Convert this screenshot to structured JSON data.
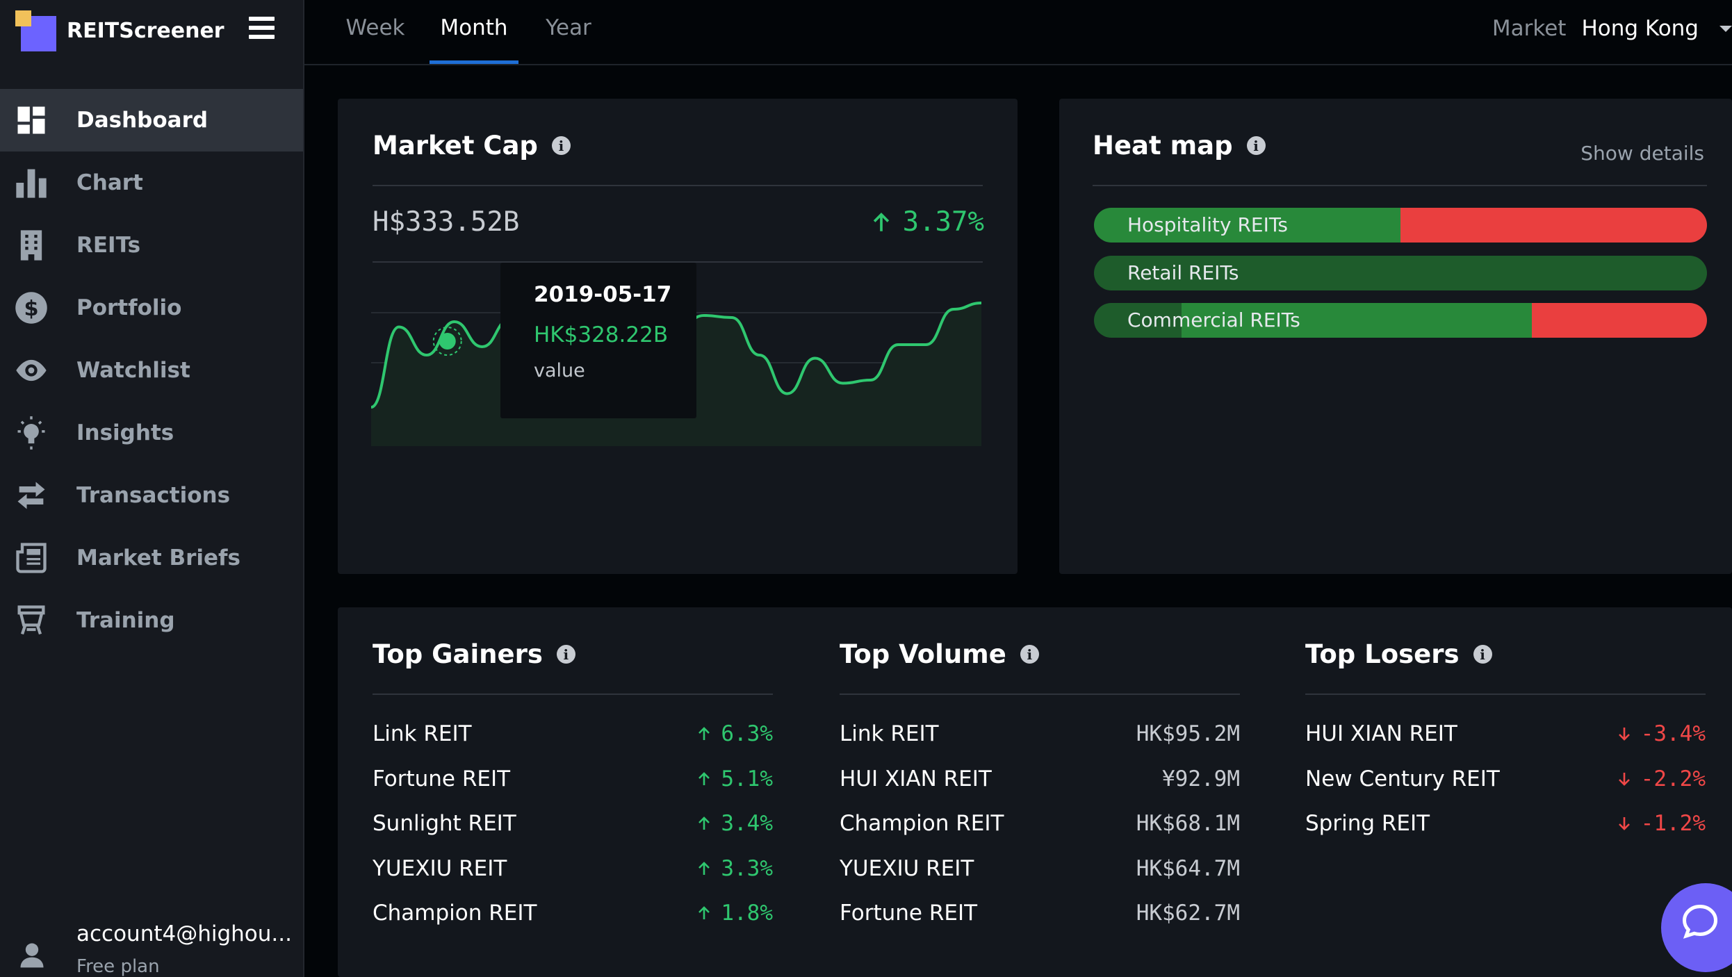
{
  "app": {
    "name": "REITScreener"
  },
  "sidebar": {
    "items": [
      {
        "label": "Dashboard",
        "icon": "dashboard-icon",
        "active": true
      },
      {
        "label": "Chart",
        "icon": "bar-chart-icon"
      },
      {
        "label": "REITs",
        "icon": "building-icon"
      },
      {
        "label": "Portfolio",
        "icon": "dollar-circle-icon"
      },
      {
        "label": "Watchlist",
        "icon": "eye-icon"
      },
      {
        "label": "Insights",
        "icon": "lightbulb-icon"
      },
      {
        "label": "Transactions",
        "icon": "swap-arrows-icon"
      },
      {
        "label": "Market Briefs",
        "icon": "newspaper-icon"
      },
      {
        "label": "Training",
        "icon": "presentation-board-icon"
      }
    ],
    "account": {
      "email": "account4@highou...",
      "plan": "Free plan"
    }
  },
  "topbar": {
    "tabs": [
      {
        "label": "Week"
      },
      {
        "label": "Month",
        "active": true
      },
      {
        "label": "Year"
      }
    ],
    "market_label": "Market",
    "market_value": "Hong Kong"
  },
  "market_cap": {
    "title": "Market Cap",
    "value": "H$333.52B",
    "change": "3.37%",
    "tooltip": {
      "date": "2019-05-17",
      "value": "HK$328.22B",
      "label": "value"
    },
    "chart_data": {
      "type": "area",
      "series": [
        {
          "values": [
            0.0,
            0.77,
            0.5,
            0.82,
            0.58,
            0.84,
            0.88,
            0.83,
            0.9,
            0.78,
            0.86,
            0.74,
            0.88,
            0.86,
            0.5,
            0.13,
            0.47,
            0.23,
            0.26,
            0.6,
            0.6,
            0.94,
            1.0
          ]
        }
      ],
      "highlight_index": 3,
      "grid": true
    }
  },
  "heat_map": {
    "title": "Heat map",
    "show_details": "Show details",
    "bars": [
      {
        "label": "Hospitality REITs",
        "segments": [
          {
            "share": 0.5,
            "color": "#28893a"
          },
          {
            "share": 0.5,
            "color": "#ea3f3f"
          }
        ]
      },
      {
        "label": "Retail REITs",
        "segments": [
          {
            "share": 1.0,
            "color": "#1e5c2b"
          }
        ]
      },
      {
        "label": "Commercial REITs",
        "segments": [
          {
            "share": 0.143,
            "color": "#1e5c2b"
          },
          {
            "share": 0.571,
            "color": "#28893a"
          },
          {
            "share": 0.286,
            "color": "#ea3f3f"
          }
        ]
      }
    ]
  },
  "top_gainers": {
    "title": "Top Gainers",
    "rows": [
      {
        "name": "Link REIT",
        "value": "6.3%"
      },
      {
        "name": "Fortune REIT",
        "value": "5.1%"
      },
      {
        "name": "Sunlight REIT",
        "value": "3.4%"
      },
      {
        "name": "YUEXIU REIT",
        "value": "3.3%"
      },
      {
        "name": "Champion REIT",
        "value": "1.8%"
      }
    ]
  },
  "top_volume": {
    "title": "Top Volume",
    "rows": [
      {
        "name": "Link REIT",
        "value": "HK$95.2M"
      },
      {
        "name": "HUI XIAN REIT",
        "value": "¥92.9M"
      },
      {
        "name": "Champion REIT",
        "value": "HK$68.1M"
      },
      {
        "name": "YUEXIU REIT",
        "value": "HK$64.7M"
      },
      {
        "name": "Fortune REIT",
        "value": "HK$62.7M"
      }
    ]
  },
  "top_losers": {
    "title": "Top Losers",
    "rows": [
      {
        "name": "HUI XIAN REIT",
        "value": "-3.4%"
      },
      {
        "name": "New Century REIT",
        "value": "-2.2%"
      },
      {
        "name": "Spring REIT",
        "value": "-1.2%"
      }
    ]
  },
  "colors": {
    "accent": "#6c5ff5",
    "tab_underline": "#1f6fd6",
    "up": "#2fc76f",
    "down": "#f04747"
  }
}
